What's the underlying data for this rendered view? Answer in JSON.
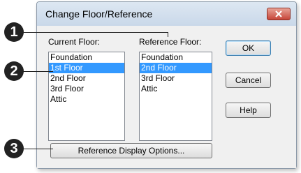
{
  "dialog": {
    "title": "Change Floor/Reference",
    "close_icon": "close-icon"
  },
  "current_floor": {
    "label": "Current Floor:",
    "items": [
      "Foundation",
      "1st Floor",
      "2nd Floor",
      "3rd Floor",
      "Attic"
    ],
    "selected": "1st Floor"
  },
  "reference_floor": {
    "label": "Reference Floor:",
    "items": [
      "Foundation",
      "2nd Floor",
      "3rd Floor",
      "Attic"
    ],
    "selected": "2nd Floor"
  },
  "buttons": {
    "ok": "OK",
    "cancel": "Cancel",
    "help": "Help",
    "reference_display_options": "Reference Display Options..."
  },
  "callouts": [
    "1",
    "2",
    "3"
  ],
  "colors": {
    "selection": "#3399ff",
    "close_button": "#c7463a",
    "callout": "#222222"
  }
}
